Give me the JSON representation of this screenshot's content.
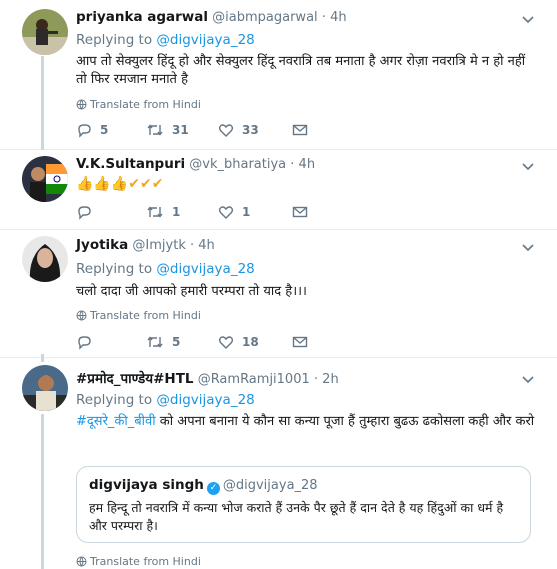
{
  "tweets": [
    {
      "name": "priyanka agarwal",
      "handle": "@iabmpagarwal",
      "dot": "·",
      "time": "4h",
      "replying_prefix": "Replying to",
      "replying_to": "@digvijaya_28",
      "text": "आप तो सेक्युलर हिंदू हो और सेक्युलर हिंदू नवरात्रि तब मनाता है अगर रोज़ा नवरात्रि मे न हो नहीं तो फिर रमजान मनाते है",
      "translate": "Translate from Hindi",
      "replies": "5",
      "retweets": "31",
      "likes": "33"
    },
    {
      "name": "V.K.Sultanpuri",
      "handle": "@vk_bharatiya",
      "dot": "·",
      "time": "4h",
      "text": "👍👍👍✔✔✔",
      "replies": "",
      "retweets": "1",
      "likes": "1"
    },
    {
      "name": "Jyotika",
      "handle": "@Imjytk",
      "dot": "·",
      "time": "4h",
      "replying_prefix": "Replying to",
      "replying_to": "@digvijaya_28",
      "text": "चलो दादा जी आपको हमारी परम्परा तो याद है।।।",
      "translate": "Translate from Hindi",
      "replies": "",
      "retweets": "5",
      "likes": "18"
    },
    {
      "name": "#प्रमोद_पाण्डेय#HTL",
      "handle": "@RamRamji1001",
      "dot": "·",
      "time": "2h",
      "replying_prefix": "Replying to",
      "replying_to": "@digvijaya_28",
      "text_tag": "#दूसरे_की_बीवी",
      "text": " को अपना बनाना ये कौन सा कन्या पूजा हैं तुम्हारा बुढऊ ढकोसला कही और करो",
      "quote": {
        "name": "digvijaya singh",
        "verified": "✓",
        "handle": "@digvijaya_28",
        "text": "हम हिन्दू तो नवरात्रि में कन्या भोज कराते हैं उनके पैर छूते हैं दान देते है यह हिंदुओं का धर्म है और परम्परा है।"
      },
      "translate": "Translate from Hindi"
    }
  ]
}
